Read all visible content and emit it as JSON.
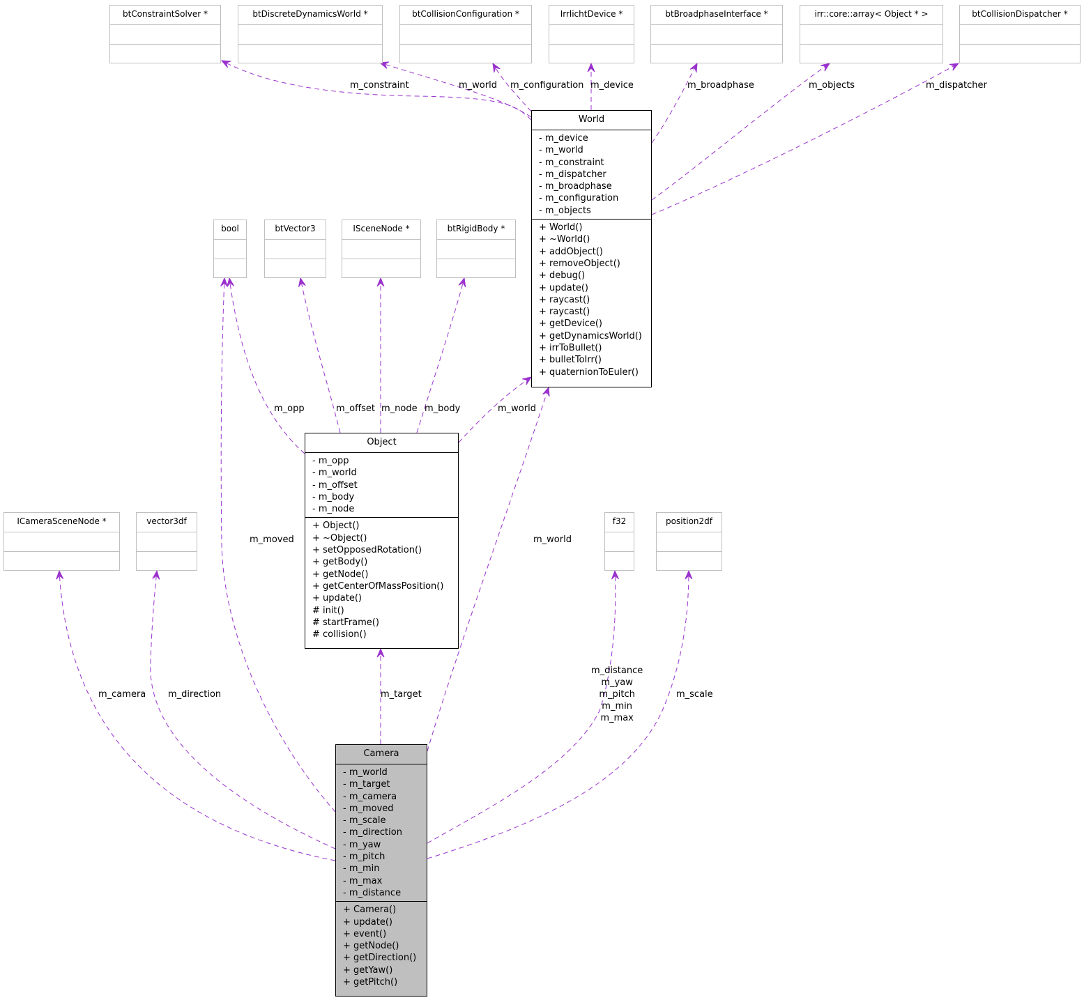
{
  "diagram": {
    "type": "collaboration-diagram",
    "colors": {
      "edge": "#9a32cd",
      "focus_fill": "#bfbfbf",
      "external_border": "#bfbfbf",
      "class_border": "#000000"
    },
    "external_types": {
      "btConstraintSolver": "btConstraintSolver *",
      "btDiscreteDynamicsWorld": "btDiscreteDynamicsWorld *",
      "btCollisionConfiguration": "btCollisionConfiguration *",
      "IrrlichtDevice": "IrrlichtDevice *",
      "btBroadphaseInterface": "btBroadphaseInterface *",
      "irrArray": "irr::core::array< Object * >",
      "btCollisionDispatcher": "btCollisionDispatcher *",
      "bool": "bool",
      "btVector3": "btVector3",
      "ISceneNode": "ISceneNode *",
      "btRigidBody": "btRigidBody *",
      "ICameraSceneNode": "ICameraSceneNode *",
      "vector3df": "vector3df",
      "f32": "f32",
      "position2df": "position2df"
    },
    "classes": {
      "world": {
        "name": "World",
        "attributes": [
          "- m_device",
          "- m_world",
          "- m_constraint",
          "- m_dispatcher",
          "- m_broadphase",
          "- m_configuration",
          "- m_objects"
        ],
        "methods": [
          "+ World()",
          "+ ~World()",
          "+ addObject()",
          "+ removeObject()",
          "+ debug()",
          "+ update()",
          "+ raycast()",
          "+ raycast()",
          "+ getDevice()",
          "+ getDynamicsWorld()",
          "+ irrToBullet()",
          "+ bulletToIrr()",
          "+ quaternionToEuler()"
        ]
      },
      "object": {
        "name": "Object",
        "attributes": [
          "- m_opp",
          "- m_world",
          "- m_offset",
          "- m_body",
          "- m_node"
        ],
        "methods": [
          "+ Object()",
          "+ ~Object()",
          "+ setOpposedRotation()",
          "+ getBody()",
          "+ getNode()",
          "+ getCenterOfMassPosition()",
          "+ update()",
          "# init()",
          "# startFrame()",
          "# collision()"
        ]
      },
      "camera": {
        "name": "Camera",
        "attributes": [
          "- m_world",
          "- m_target",
          "- m_camera",
          "- m_moved",
          "- m_scale",
          "- m_direction",
          "- m_yaw",
          "- m_pitch",
          "- m_min",
          "- m_max",
          "- m_distance"
        ],
        "methods": [
          "+ Camera()",
          "+ update()",
          "+ event()",
          "+ getNode()",
          "+ getDirection()",
          "+ getYaw()",
          "+ getPitch()"
        ]
      }
    },
    "edges": [
      {
        "from": "World",
        "to": "btConstraintSolver *",
        "label": "m_constraint"
      },
      {
        "from": "World",
        "to": "btDiscreteDynamicsWorld *",
        "label": "m_world"
      },
      {
        "from": "World",
        "to": "btCollisionConfiguration *",
        "label": "m_configuration"
      },
      {
        "from": "World",
        "to": "IrrlichtDevice *",
        "label": "m_device"
      },
      {
        "from": "World",
        "to": "btBroadphaseInterface *",
        "label": "m_broadphase"
      },
      {
        "from": "World",
        "to": "irr::core::array< Object * >",
        "label": "m_objects"
      },
      {
        "from": "World",
        "to": "btCollisionDispatcher *",
        "label": "m_dispatcher"
      },
      {
        "from": "Object",
        "to": "bool",
        "label": "m_opp"
      },
      {
        "from": "Object",
        "to": "btVector3",
        "label": "m_offset"
      },
      {
        "from": "Object",
        "to": "ISceneNode *",
        "label": "m_node"
      },
      {
        "from": "Object",
        "to": "btRigidBody *",
        "label": "m_body"
      },
      {
        "from": "Object",
        "to": "World",
        "label": "m_world"
      },
      {
        "from": "Camera",
        "to": "bool",
        "label": "m_moved"
      },
      {
        "from": "Camera",
        "to": "World",
        "label": "m_world"
      },
      {
        "from": "Camera",
        "to": "Object",
        "label": "m_target"
      },
      {
        "from": "Camera",
        "to": "ICameraSceneNode *",
        "label": "m_camera"
      },
      {
        "from": "Camera",
        "to": "vector3df",
        "label": "m_direction"
      },
      {
        "from": "Camera",
        "to": "f32",
        "label": "m_distance\nm_yaw\nm_pitch\nm_min\nm_max"
      },
      {
        "from": "Camera",
        "to": "position2df",
        "label": "m_scale"
      }
    ]
  }
}
